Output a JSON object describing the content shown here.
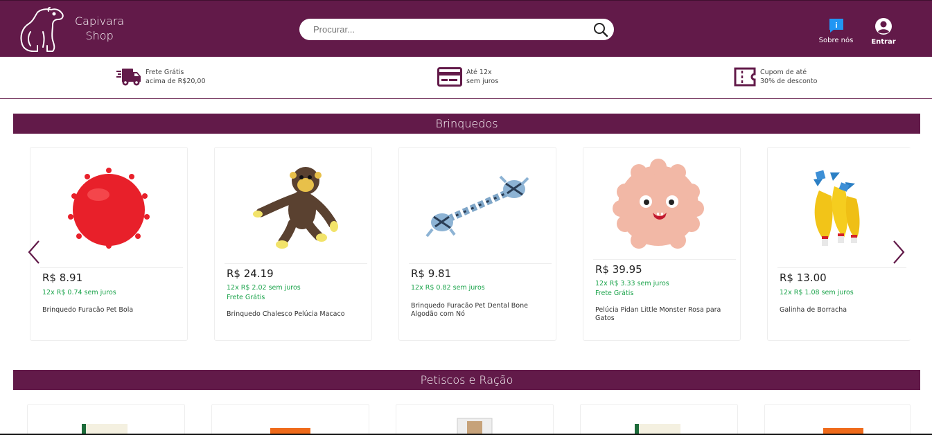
{
  "header": {
    "brand_line1": "Capivara",
    "brand_line2": "Shop",
    "search_placeholder": "Procurar...",
    "about_label": "Sobre nós",
    "login_label": "Entrar",
    "brand_color": "#621a49"
  },
  "benefits": [
    {
      "icon": "delivery-truck-icon",
      "line1": "Frete Grátis",
      "line2": "acima de R$20,00"
    },
    {
      "icon": "credit-card-icon",
      "line1": "Até 12x",
      "line2": "sem juros"
    },
    {
      "icon": "coupon-icon",
      "line1": "Cupom de até",
      "line2": "30% de desconto"
    }
  ],
  "sections": [
    {
      "title": "Brinquedos"
    },
    {
      "title": "Petiscos e Ração"
    }
  ],
  "products": [
    {
      "price": "R$ 8.91",
      "installments": "12x R$ 0.74 sem juros",
      "shipping": "",
      "name": "Brinquedo Furacão Pet Bola"
    },
    {
      "price": "R$ 24.19",
      "installments": "12x R$ 2.02 sem juros",
      "shipping": "Frete Grátis",
      "name": "Brinquedo Chalesco Pelúcia Macaco"
    },
    {
      "price": "R$ 9.81",
      "installments": "12x R$ 0.82 sem juros",
      "shipping": "",
      "name": "Brinquedo Furacão Pet Dental Bone Algodão com Nó"
    },
    {
      "price": "R$ 39.95",
      "installments": "12x R$ 3.33 sem juros",
      "shipping": "Frete Grátis",
      "name": "Pelúcia Pidan Little Monster Rosa para Gatos"
    },
    {
      "price": "R$ 13.00",
      "installments": "12x R$ 1.08 sem juros",
      "shipping": "",
      "name": "Galinha de Borracha"
    }
  ]
}
